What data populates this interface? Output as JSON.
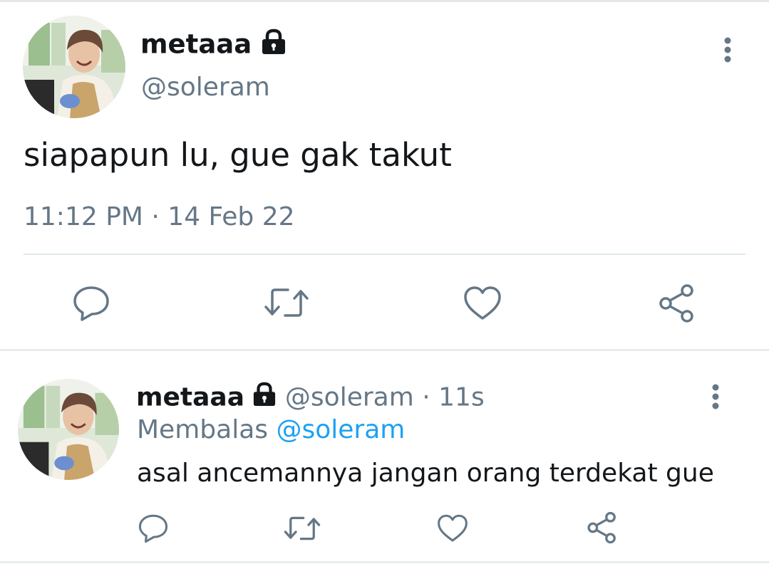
{
  "main_tweet": {
    "display_name": "metaaa",
    "handle": "@soleram",
    "text": "siapapun lu, gue gak takut",
    "timestamp": "11:12 PM · 14 Feb 22",
    "icons": [
      "lock-icon",
      "more-vertical-icon",
      "reply-icon",
      "retweet-icon",
      "like-icon",
      "share-icon"
    ]
  },
  "reply_tweet": {
    "display_name": "metaaa",
    "handle": "@soleram",
    "time_ago": "· 11s",
    "replying_prefix": "Membalas",
    "replying_to": "@soleram",
    "text": "asal ancemannya jangan orang terdekat gue",
    "icons": [
      "lock-icon",
      "more-vertical-icon",
      "reply-icon",
      "retweet-icon",
      "like-icon",
      "share-icon"
    ]
  },
  "colors": {
    "text": "#14171a",
    "muted": "#657786",
    "link": "#1da1f2",
    "divider": "#e1e8ed"
  }
}
